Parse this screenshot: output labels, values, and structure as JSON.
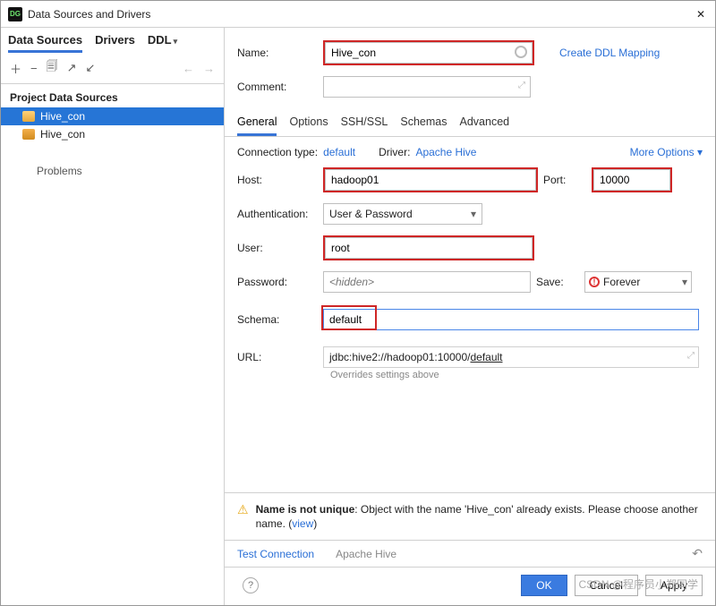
{
  "window": {
    "title": "Data Sources and Drivers"
  },
  "sidebar": {
    "tabs": [
      "Data Sources",
      "Drivers",
      "DDL"
    ],
    "section_header": "Project Data Sources",
    "items": [
      {
        "label": "Hive_con",
        "selected": true
      },
      {
        "label": "Hive_con",
        "selected": false
      }
    ],
    "problems": "Problems"
  },
  "form": {
    "name_label": "Name:",
    "name_value": "Hive_con",
    "create_ddl": "Create DDL Mapping",
    "comment_label": "Comment:",
    "comment_value": ""
  },
  "main_tabs": [
    "General",
    "Options",
    "SSH/SSL",
    "Schemas",
    "Advanced"
  ],
  "conn": {
    "type_label": "Connection type:",
    "type_value": "default",
    "driver_label": "Driver:",
    "driver_value": "Apache Hive",
    "more": "More Options"
  },
  "fields": {
    "host_label": "Host:",
    "host_value": "hadoop01",
    "port_label": "Port:",
    "port_value": "10000",
    "auth_label": "Authentication:",
    "auth_value": "User & Password",
    "user_label": "User:",
    "user_value": "root",
    "pw_label": "Password:",
    "pw_placeholder": "<hidden>",
    "save_label": "Save:",
    "save_value": "Forever",
    "schema_label": "Schema:",
    "schema_value": "default",
    "url_label": "URL:",
    "url_prefix": "jdbc:hive2://hadoop01:10000/",
    "url_db": "default",
    "url_note": "Overrides settings above"
  },
  "warning": {
    "title": "Name is not unique",
    "body": ": Object with the name 'Hive_con' already exists. Please choose another name. (",
    "view": "view",
    "tail": ")"
  },
  "footer": {
    "test": "Test Connection",
    "driver": "Apache Hive",
    "ok": "OK",
    "cancel": "Cancel",
    "apply": "Apply"
  },
  "watermark": "CSDN @程序员小郑同学"
}
